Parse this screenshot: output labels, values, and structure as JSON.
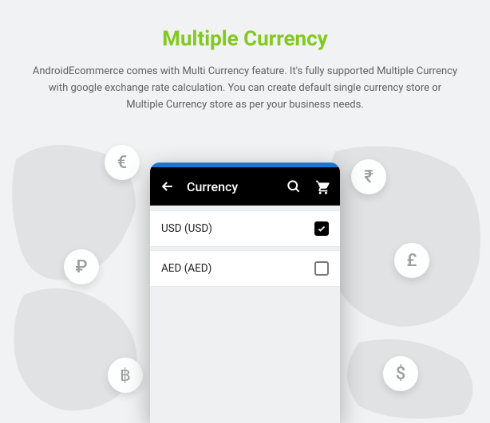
{
  "header": {
    "title": "Multiple Currency",
    "description": "AndroidEcommerce comes with Multi Currency feature. It's fully supported Multiple Currency with google exchange rate calculation. You can create default single currency store or Multiple Currency store as per your business needs."
  },
  "coins": {
    "euro": "€",
    "rupee": "₹",
    "ruble": "₽",
    "pound": "£",
    "baht": "฿",
    "dollar": "$"
  },
  "phone": {
    "appbar_title": "Currency",
    "rows": [
      {
        "label": "USD (USD)",
        "checked": true
      },
      {
        "label": "AED (AED)",
        "checked": false
      }
    ]
  }
}
